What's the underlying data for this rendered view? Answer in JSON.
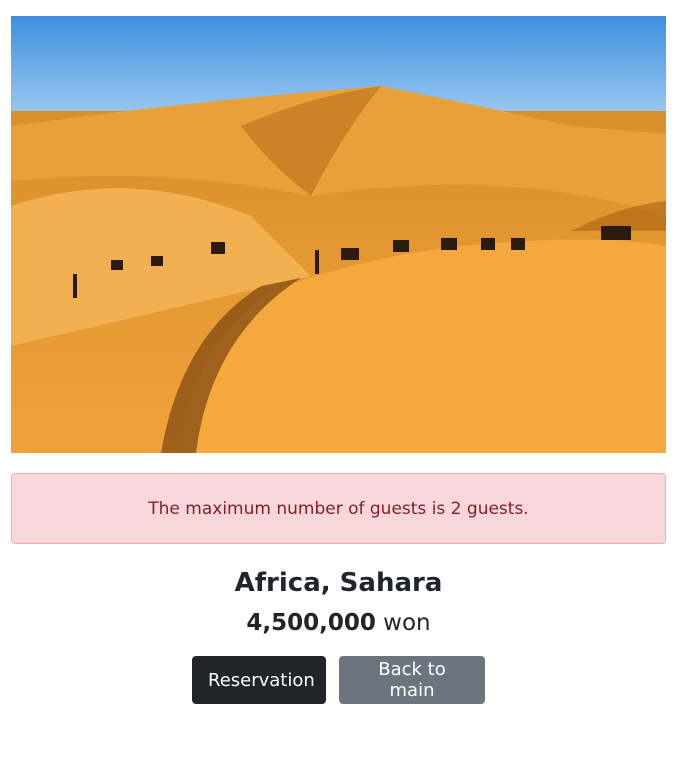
{
  "alert": {
    "text": "The maximum number of guests is 2 guests."
  },
  "destination": {
    "title": "Africa, Sahara",
    "price": "4,500,000",
    "currency": "won"
  },
  "buttons": {
    "reservation": "Reservation",
    "back": "Back to main"
  },
  "colors": {
    "alert_bg": "#f8d7da",
    "alert_text": "#842029",
    "btn_dark": "#212529",
    "btn_gray": "#6c757d"
  }
}
